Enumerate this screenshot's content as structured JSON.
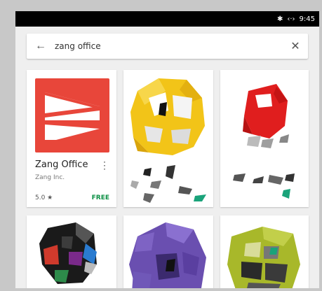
{
  "status_bar": {
    "bluetooth_icon": "bluetooth-icon",
    "signal_icon": "link-icon",
    "time": "9:45"
  },
  "search": {
    "back_icon": "arrow-left-icon",
    "query": "zang office",
    "clear_icon": "close-icon"
  },
  "results": [
    {
      "title": "Zang Office",
      "developer": "Zang Inc.",
      "rating": "5.0 ★",
      "price": "FREE",
      "icon": "zang-logo-icon",
      "colors": {
        "icon_bg": "#e8463a",
        "price": "#0b8f43"
      }
    }
  ]
}
